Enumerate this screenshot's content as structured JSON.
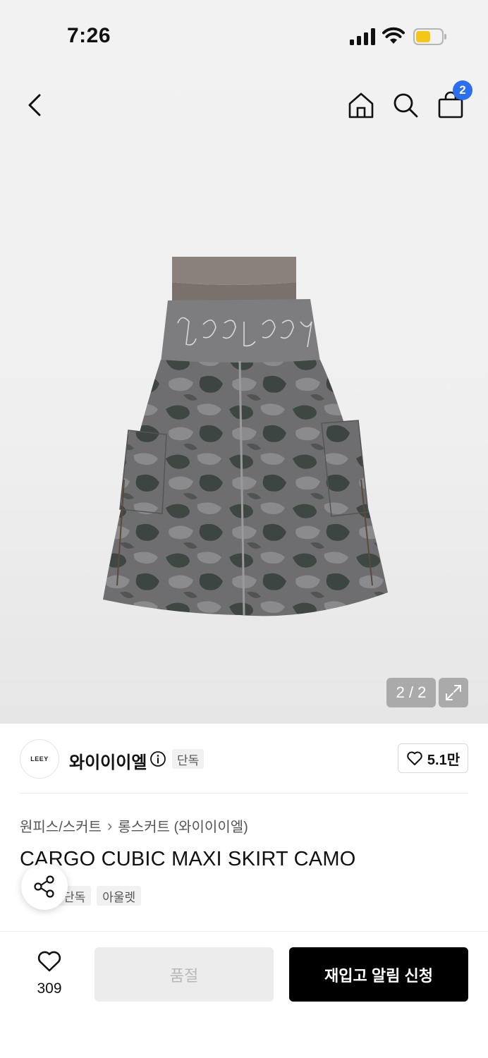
{
  "status_bar": {
    "time": "7:26",
    "battery_color": "#f5c518"
  },
  "top_nav": {
    "cart_count": "2",
    "badge_color": "#2b6ef2"
  },
  "gallery": {
    "pager": "2 / 2"
  },
  "brand": {
    "logo_text": "LEEY",
    "name": "와이이이엘",
    "exclusive_tag": "단독",
    "likes": "5.1만"
  },
  "breadcrumb": {
    "category": "원피스/스커트",
    "subcategory": "롱스커트 (와이이이엘)"
  },
  "product": {
    "title": "CARGO CUBIC MAXI SKIRT CAMO",
    "tags": [
      "단독",
      "아울렛"
    ]
  },
  "bottom_bar": {
    "wish_count": "309",
    "soldout_label": "품절",
    "restock_label": "재입고 알림 신청"
  },
  "colors": {
    "primary_button": "#000000",
    "disabled_button": "#ececec"
  }
}
